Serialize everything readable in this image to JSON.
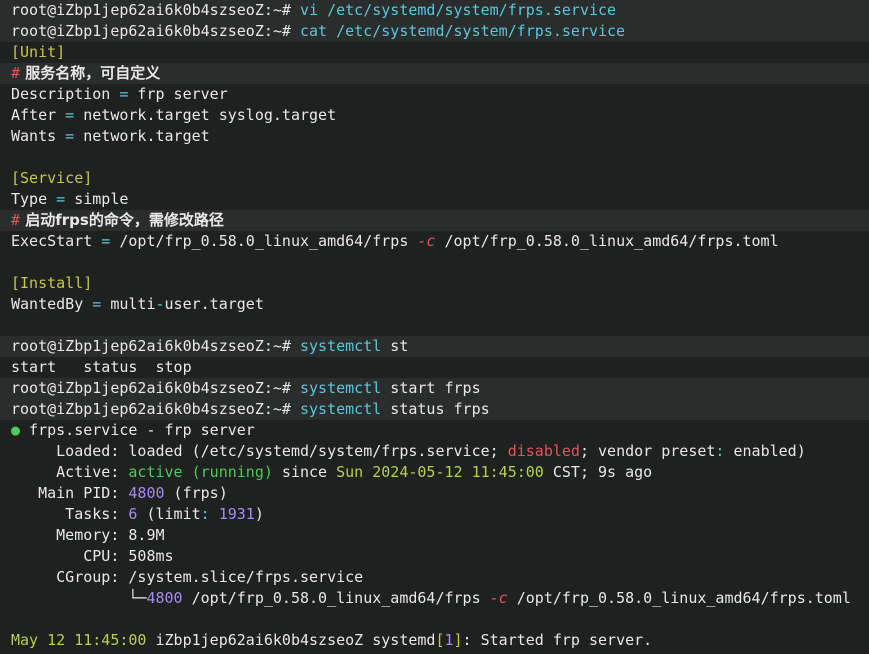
{
  "prompt": "root@iZbp1jep62ai6k0b4szseoZ:~# ",
  "commands": {
    "vi": "vi /etc/systemd/system/frps.service",
    "cat": "cat /etc/systemd/system/frps.service",
    "systemctl_cmd": "systemctl",
    "st_arg": " st",
    "start_arg": " start frps",
    "status_arg": " status frps"
  },
  "file": {
    "unit_header": "[Unit]",
    "comment_hash": "#",
    "comment1": " 服务名称，可自定义",
    "desc_key": "Description",
    "desc_val": " frp server",
    "after_key": "After",
    "after_val": " network.target syslog.target",
    "wants_key": "Wants",
    "wants_val": " network.target",
    "service_header": "[Service]",
    "type_key": "Type",
    "type_val": " simple",
    "comment2": " 启动frps的命令，需修改路径",
    "exec_key": "ExecStart",
    "exec_path1": " /opt/frp_0.58.0_linux_amd64/frps ",
    "exec_flag": "-c",
    "exec_path2": " /opt/frp_0.58.0_linux_amd64/frps.toml",
    "install_header": "[Install]",
    "wantedby_key": "WantedBy",
    "wantedby_val1": " multi",
    "wantedby_dash": "-",
    "wantedby_val2": "user.target",
    "eq": " ="
  },
  "completion": "start   status  stop",
  "status": {
    "dot": "●",
    "unit_name": " frps.service - frp server",
    "loaded_label": "     Loaded:",
    "loaded_pre": " loaded (/etc/systemd/system/frps.service; ",
    "loaded_disabled": "disabled",
    "loaded_mid": "; vendor preset",
    "loaded_colon": ":",
    "loaded_enabled": " enabled)",
    "active_label": "     Active:",
    "active_state": " active (running)",
    "active_since": " since ",
    "active_date": "Sun 2024-05-12 11:45:00",
    "active_tz": " CST; 9s ago",
    "pid_label": "   Main PID:",
    "pid_value": " 4800",
    "pid_name": " (frps)",
    "tasks_label": "      Tasks:",
    "tasks_value": " 6",
    "tasks_limit_pre": " (limit",
    "tasks_limit_colon": ":",
    "tasks_limit_value": " 1931",
    "tasks_limit_post": ")",
    "memory_label": "     Memory:",
    "memory_value": " 8.9M",
    "cpu_label": "        CPU:",
    "cpu_value": " 508ms",
    "cgroup_label": "     CGroup:",
    "cgroup_value": " /system.slice/frps.service",
    "tree_prefix": "             └─",
    "tree_pid": "4800",
    "tree_path1": " /opt/frp_0.58.0_linux_amd64/frps ",
    "tree_flag": "-c",
    "tree_path2": " /opt/frp_0.58.0_linux_amd64/frps.toml"
  },
  "log": {
    "timestamp": "May 12 11:45:00",
    "host_unit": " iZbp1jep62ai6k0b4szseoZ systemd",
    "pid_open": "[",
    "pid": "1",
    "pid_close": "]",
    "message": ": Started frp server."
  },
  "colors": {
    "background": "#1f2020",
    "highlight": "#2b2c2c",
    "command": "#56c8e0",
    "bracket": "#c9c64a",
    "error": "#e5535b",
    "active": "#4ec95a",
    "timestamp": "#b9cf52",
    "number": "#a68cf2"
  }
}
